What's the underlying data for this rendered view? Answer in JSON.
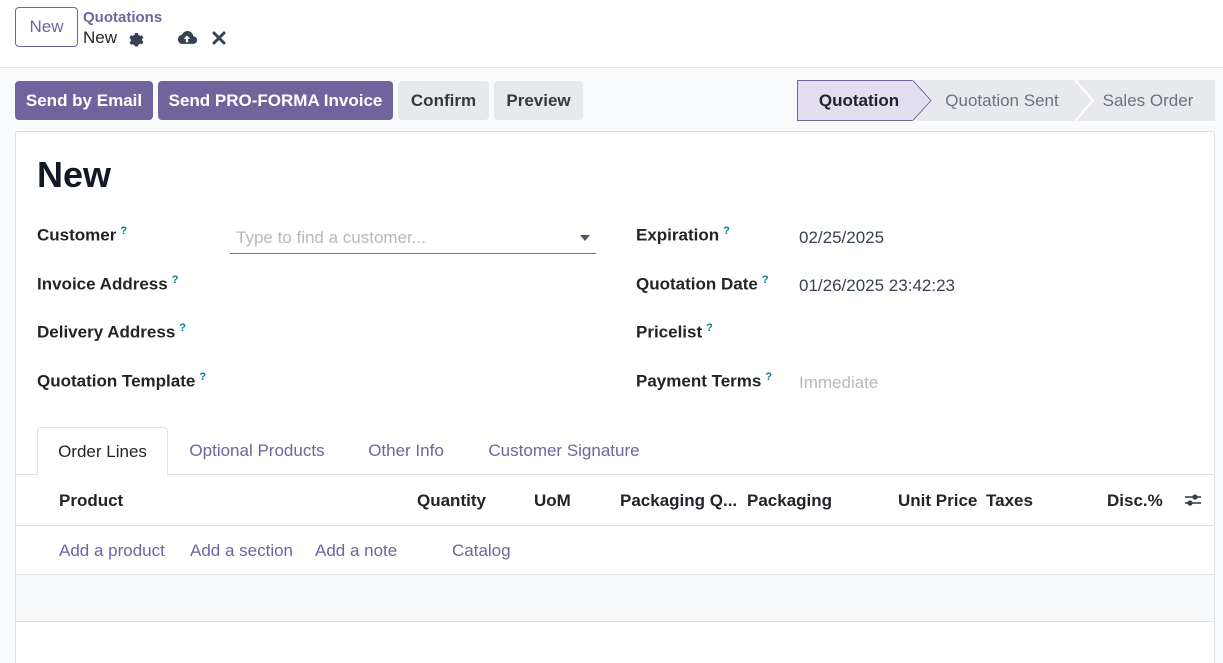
{
  "topbar": {
    "new_button": "New",
    "breadcrumb_parent": "Quotations",
    "breadcrumb_current": "New"
  },
  "actions": {
    "send_email": "Send by Email",
    "send_proforma": "Send PRO-FORMA Invoice",
    "confirm": "Confirm",
    "preview": "Preview"
  },
  "status_stages": [
    "Quotation",
    "Quotation Sent",
    "Sales Order"
  ],
  "form": {
    "title": "New",
    "left": {
      "customer_label": "Customer",
      "customer_placeholder": "Type to find a customer...",
      "invoice_address_label": "Invoice Address",
      "delivery_address_label": "Delivery Address",
      "quotation_template_label": "Quotation Template"
    },
    "right": {
      "expiration_label": "Expiration",
      "expiration_value": "02/25/2025",
      "quotation_date_label": "Quotation Date",
      "quotation_date_value": "01/26/2025 23:42:23",
      "pricelist_label": "Pricelist",
      "payment_terms_label": "Payment Terms",
      "payment_terms_placeholder": "Immediate"
    },
    "help_mark": "?"
  },
  "tabs": [
    "Order Lines",
    "Optional Products",
    "Other Info",
    "Customer Signature"
  ],
  "table": {
    "columns": [
      "Product",
      "Quantity",
      "UoM",
      "Packaging Q...",
      "Packaging",
      "Unit Price",
      "Taxes",
      "Disc.%"
    ]
  },
  "add_links": {
    "product": "Add a product",
    "section": "Add a section",
    "note": "Add a note",
    "catalog": "Catalog"
  },
  "colors": {
    "primary": "#71639e",
    "help": "#017e84",
    "active_stage_bg": "#e2ddf0"
  }
}
